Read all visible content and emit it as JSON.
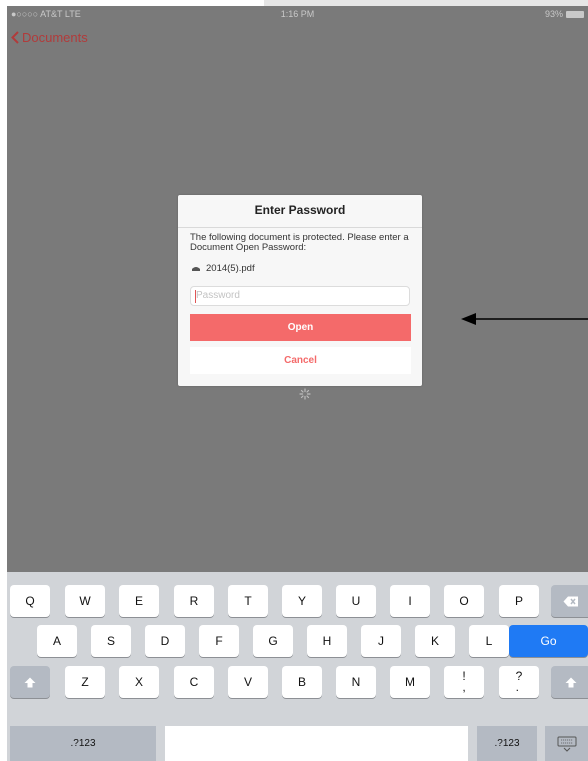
{
  "status_bar": {
    "carrier": "●○○○○ AT&T  LTE",
    "time": "1:16 PM",
    "battery": "93%"
  },
  "nav": {
    "back_label": "Documents"
  },
  "dialog": {
    "title": "Enter Password",
    "message": "The following document is protected. Please enter a Document Open Password:",
    "filename": "2014(5).pdf",
    "password_placeholder": "Password",
    "open_label": "Open",
    "cancel_label": "Cancel"
  },
  "keyboard": {
    "row1": [
      "Q",
      "W",
      "E",
      "R",
      "T",
      "Y",
      "U",
      "I",
      "O",
      "P"
    ],
    "row2": [
      "A",
      "S",
      "D",
      "F",
      "G",
      "H",
      "J",
      "K",
      "L"
    ],
    "go_label": "Go",
    "row3": [
      "Z",
      "X",
      "C",
      "V",
      "B",
      "N",
      "M"
    ],
    "punct1": "!\n,",
    "punct2": "?\n.",
    "numbers_label": ".?123"
  },
  "colors": {
    "accent": "#f46a6a",
    "back_link": "#b13b3b",
    "go_key": "#1f7af4"
  }
}
